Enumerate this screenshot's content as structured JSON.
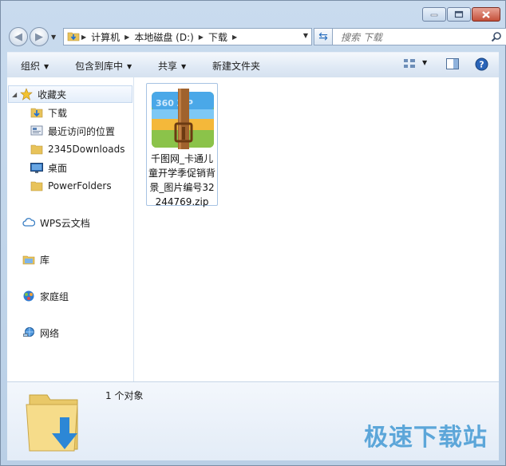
{
  "address": {
    "segments": [
      "计算机",
      "本地磁盘 (D:)",
      "下载"
    ]
  },
  "search": {
    "placeholder": "搜索 下载"
  },
  "toolbar": {
    "organize": "组织",
    "include_in_library": "包含到库中",
    "share": "共享",
    "new_folder": "新建文件夹"
  },
  "sidebar": {
    "favorites": "收藏夹",
    "items": [
      "下载",
      "最近访问的位置",
      "2345Downloads",
      "桌面",
      "PowerFolders"
    ],
    "wps": "WPS云文档",
    "libraries": "库",
    "homegroup": "家庭组",
    "network": "网络"
  },
  "file": {
    "name": "千图网_卡通儿童开学季促销背景_图片编号32244769.zip",
    "icon_text": "360 ZIP"
  },
  "status": {
    "count": "1 个对象"
  },
  "watermark": "极速下载站",
  "colors": {
    "accent": "#4d9fd6",
    "chrome": "#c9dbee",
    "close": "#c4503a"
  }
}
